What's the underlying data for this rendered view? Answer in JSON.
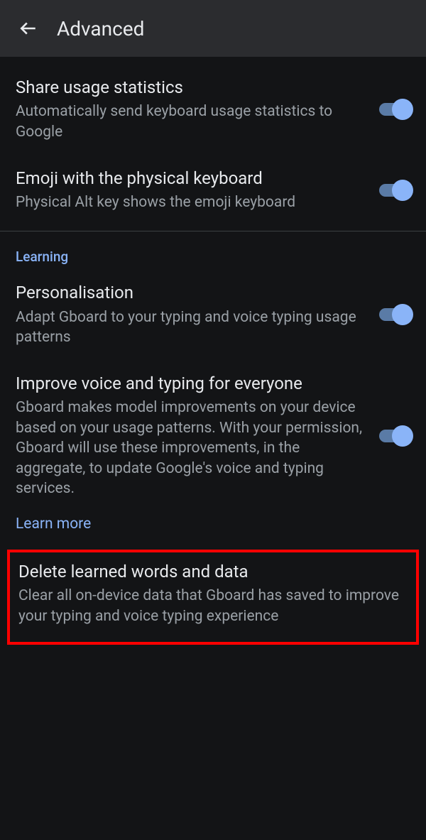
{
  "header": {
    "title": "Advanced"
  },
  "settings": {
    "shareUsage": {
      "title": "Share usage statistics",
      "desc": "Automatically send keyboard usage statistics to Google"
    },
    "emojiPhysical": {
      "title": "Emoji with the physical keyboard",
      "desc": "Physical Alt key shows the emoji keyboard"
    },
    "learningSection": "Learning",
    "personalisation": {
      "title": "Personalisation",
      "desc": "Adapt Gboard to your typing and voice typing usage patterns"
    },
    "improveVoice": {
      "title": "Improve voice and typing for everyone",
      "desc": "Gboard makes model improvements on your device based on your usage patterns. With your permission, Gboard will use these improvements, in the aggregate, to update Google's voice and typing services."
    },
    "learnMore": "Learn more",
    "deleteLearned": {
      "title": "Delete learned words and data",
      "desc": "Clear all on-device data that Gboard has saved to improve your typing and voice typing experience"
    }
  }
}
